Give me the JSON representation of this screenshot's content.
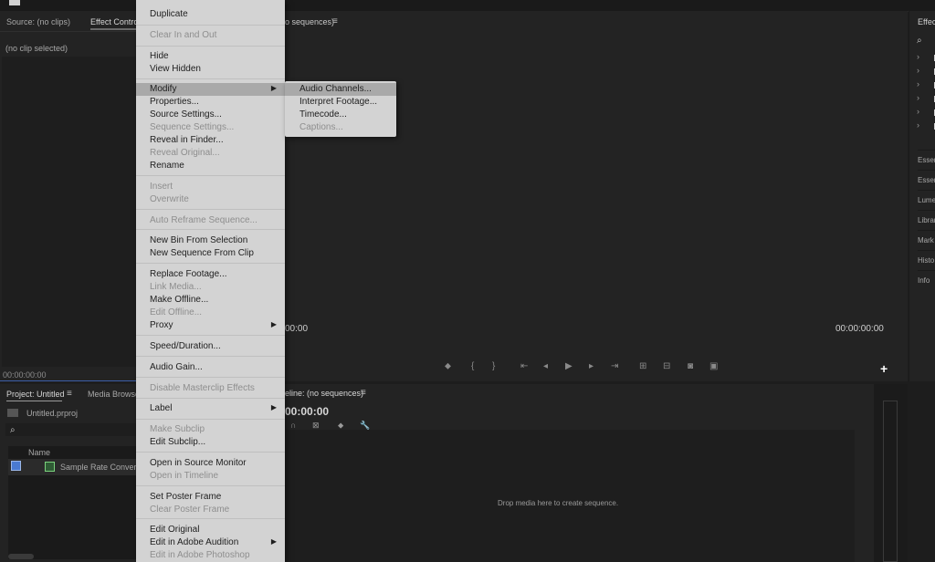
{
  "source_panel": {
    "tab_source": "Source: (no clips)",
    "tab_effect_controls": "Effect Controls",
    "no_clip": "(no clip selected)",
    "timecode": "00:00:00:00"
  },
  "program_monitor": {
    "title": "o sequences)",
    "menu_icon": "≡",
    "timecode_left": "00:00",
    "timecode_right": "00:00:00:00",
    "add": "+"
  },
  "effects_panel": {
    "title": "Effec",
    "tabs": [
      "Essen",
      "Essen",
      "Lume",
      "Librar",
      "Mark",
      "Histo",
      "Info"
    ]
  },
  "project_panel": {
    "tab_project": "Project: Untitled",
    "tab_menu": "≡",
    "tab_media_browser": "Media Browse",
    "project_file": "Untitled.prproj",
    "column_name": "Name",
    "item": "Sample Rate Conversio"
  },
  "timeline_panel": {
    "title": "eline: (no sequences)",
    "menu_icon": "≡",
    "timecode": "00:00:00",
    "drop_hint": "Drop media here to create sequence."
  },
  "context_menu": {
    "items": [
      {
        "label": "Duplicate",
        "enabled": true
      },
      {
        "label": "Clear In and Out",
        "enabled": false
      },
      {
        "label": "Hide",
        "enabled": true
      },
      {
        "label": "View Hidden",
        "enabled": true
      },
      {
        "label": "Modify",
        "enabled": true,
        "submenu": true,
        "highlighted": true
      },
      {
        "label": "Properties...",
        "enabled": true
      },
      {
        "label": "Source Settings...",
        "enabled": true
      },
      {
        "label": "Sequence Settings...",
        "enabled": false
      },
      {
        "label": "Reveal in Finder...",
        "enabled": true
      },
      {
        "label": "Reveal Original...",
        "enabled": false
      },
      {
        "label": "Rename",
        "enabled": true
      },
      {
        "label": "Insert",
        "enabled": false
      },
      {
        "label": "Overwrite",
        "enabled": false
      },
      {
        "label": "Auto Reframe Sequence...",
        "enabled": false
      },
      {
        "label": "New Bin From Selection",
        "enabled": true
      },
      {
        "label": "New Sequence From Clip",
        "enabled": true
      },
      {
        "label": "Replace Footage...",
        "enabled": true
      },
      {
        "label": "Link Media...",
        "enabled": false
      },
      {
        "label": "Make Offline...",
        "enabled": true
      },
      {
        "label": "Edit Offline...",
        "enabled": false
      },
      {
        "label": "Proxy",
        "enabled": true,
        "submenu": true
      },
      {
        "label": "Speed/Duration...",
        "enabled": true
      },
      {
        "label": "Audio Gain...",
        "enabled": true
      },
      {
        "label": "Disable Masterclip Effects",
        "enabled": false
      },
      {
        "label": "Label",
        "enabled": true,
        "submenu": true
      },
      {
        "label": "Make Subclip",
        "enabled": false
      },
      {
        "label": "Edit Subclip...",
        "enabled": true
      },
      {
        "label": "Open in Source Monitor",
        "enabled": true
      },
      {
        "label": "Open in Timeline",
        "enabled": false
      },
      {
        "label": "Set Poster Frame",
        "enabled": true
      },
      {
        "label": "Clear Poster Frame",
        "enabled": false
      },
      {
        "label": "Edit Original",
        "enabled": true
      },
      {
        "label": "Edit in Adobe Audition",
        "enabled": true,
        "submenu": true
      },
      {
        "label": "Edit in Adobe Photoshop",
        "enabled": false
      }
    ]
  },
  "submenu": {
    "items": [
      {
        "label": "Audio Channels...",
        "enabled": true,
        "highlighted": true
      },
      {
        "label": "Interpret Footage...",
        "enabled": true
      },
      {
        "label": "Timecode...",
        "enabled": true
      },
      {
        "label": "Captions...",
        "enabled": false
      }
    ]
  }
}
